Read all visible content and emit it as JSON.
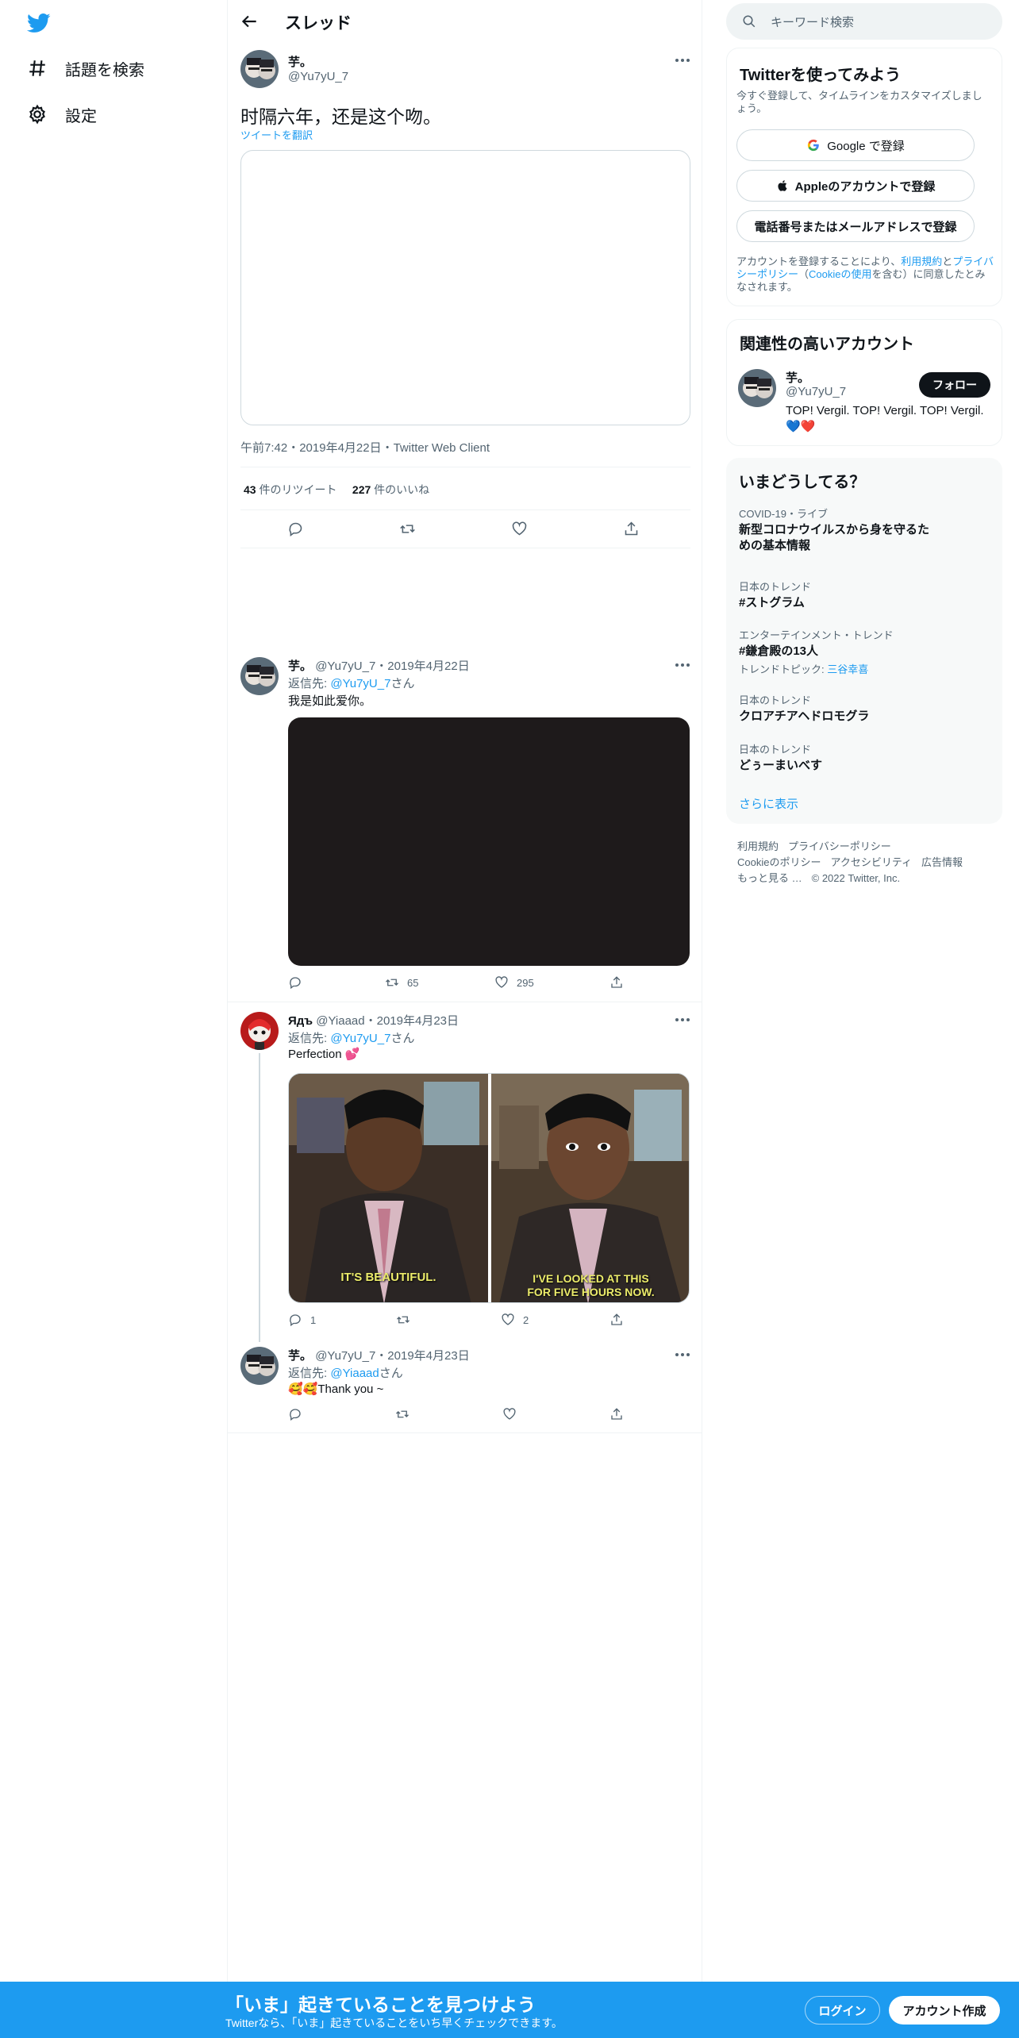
{
  "nav": {
    "explore_label": "話題を検索",
    "settings_label": "設定"
  },
  "header": {
    "title": "スレッド"
  },
  "main_tweet": {
    "name": "芋。",
    "handle": "@Yu7yU_7",
    "text": "时隔六年，还是这个吻。",
    "translate": "ツイートを翻訳",
    "meta": "午前7:42・2019年4月22日・Twitter Web Client",
    "retweets": "43",
    "retweets_label": "件のリツイート",
    "likes": "227",
    "likes_label": "件のいいね"
  },
  "replies": [
    {
      "name": "芋。",
      "handle": "@Yu7yU_7",
      "date": "・2019年4月22日",
      "reply_prefix": "返信先: ",
      "reply_to": "@Yu7yU_7",
      "reply_suffix": "さん",
      "text": "我是如此爱你。",
      "reply_count": "",
      "retweet_count": "65",
      "like_count": "295"
    },
    {
      "name": "Ядъ",
      "handle": "@Yiaaad",
      "date": "・2019年4月23日",
      "reply_prefix": "返信先: ",
      "reply_to": "@Yu7yU_7",
      "reply_suffix": "さん",
      "text": "Perfection 💕",
      "gif_left_caption": "IT'S BEAUTIFUL.",
      "gif_right_caption_1": "I'VE LOOKED AT THIS",
      "gif_right_caption_2": "FOR FIVE HOURS NOW.",
      "reply_count": "1",
      "retweet_count": "",
      "like_count": "2"
    },
    {
      "name": "芋。",
      "handle": "@Yu7yU_7",
      "date": "・2019年4月23日",
      "reply_prefix": "返信先: ",
      "reply_to": "@Yiaaad",
      "reply_suffix": "さん",
      "text": "🥰🥰Thank you ~",
      "reply_count": "",
      "retweet_count": "",
      "like_count": ""
    }
  ],
  "sidebar": {
    "search_placeholder": "キーワード検索",
    "signup": {
      "title": "Twitterを使ってみよう",
      "subtitle": "今すぐ登録して、タイムラインをカスタマイズしましょう。",
      "google": "Google で登録",
      "apple": "Appleのアカウントで登録",
      "phone": "電話番号またはメールアドレスで登録",
      "terms_1": "アカウントを登録することにより、",
      "terms_link_1": "利用規約",
      "terms_2": "と",
      "terms_link_2": "プライバシーポリシー",
      "terms_3": "（",
      "terms_link_3": "Cookieの使用",
      "terms_4": "を含む）に同意したとみなされます。"
    },
    "related": {
      "title": "関連性の高いアカウント",
      "name": "芋。",
      "handle": "@Yu7yU_7",
      "follow": "フォロー",
      "bio": "TOP! Vergil. TOP! Vergil. TOP! Vergil. 💙❤️"
    },
    "trends": {
      "title": "いまどうしてる？",
      "items": [
        {
          "category": "COVID-19・ライブ",
          "title": "新型コロナウイルスから身を守るための基本情報"
        },
        {
          "category": "日本のトレンド",
          "title": "#ストグラム"
        },
        {
          "category": "エンターテインメント・トレンド",
          "title": "#鎌倉殿の13人",
          "extra_prefix": "トレンドトピック: ",
          "extra_link": "三谷幸喜"
        },
        {
          "category": "日本のトレンド",
          "title": "クロアチアヘドロモグラ"
        },
        {
          "category": "日本のトレンド",
          "title": "どぅーまいべす"
        }
      ],
      "show_more": "さらに表示"
    },
    "footer": {
      "links": [
        "利用規約",
        "プライバシーポリシー",
        "Cookieのポリシー",
        "アクセシビリティ",
        "広告情報",
        "もっと見る …"
      ],
      "copyright": "© 2022 Twitter, Inc."
    }
  },
  "banner": {
    "title": "「いま」起きていることを見つけよう",
    "subtitle": "Twitterなら、「いま」起きていることをいち早くチェックできます。",
    "login": "ログイン",
    "signup": "アカウント作成"
  },
  "colors": {
    "accent": "#1d9bf0",
    "text": "#0f1419",
    "muted": "#536471",
    "like_red": "#f91880"
  }
}
